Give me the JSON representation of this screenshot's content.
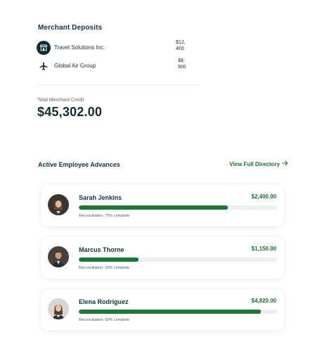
{
  "merchant_deposits": {
    "title": "Merchant Deposits",
    "items": [
      {
        "name": "Travel Solutions Inc.",
        "amount_line1": "$12,",
        "amount_line2": "400",
        "icon": "storefront-icon"
      },
      {
        "name": "Global Air Group",
        "amount_line1": "$8,",
        "amount_line2": "900",
        "icon": "airplane-icon"
      }
    ],
    "total_label": "Total Merchant Credit",
    "total_value": "$45,302.00"
  },
  "advances": {
    "title": "Active Employee Advances",
    "directory_link": "View Full Directory",
    "employees": [
      {
        "name": "Sarah Jenkins",
        "amount": "$2,400.00",
        "progress": 0.75,
        "status": "Reconciliation: 75% complete"
      },
      {
        "name": "Marcus Thorne",
        "amount": "$1,150.00",
        "progress": 0.3,
        "status": "Reconciliation: 30% complete"
      },
      {
        "name": "Elena Rodriguez",
        "amount": "$4,820.00",
        "progress": 0.92,
        "status": "Reconciliation: 92% complete"
      }
    ]
  },
  "colors": {
    "accent": "#1a7a33",
    "link": "#1f6b2f",
    "text": "#0f2b36"
  }
}
